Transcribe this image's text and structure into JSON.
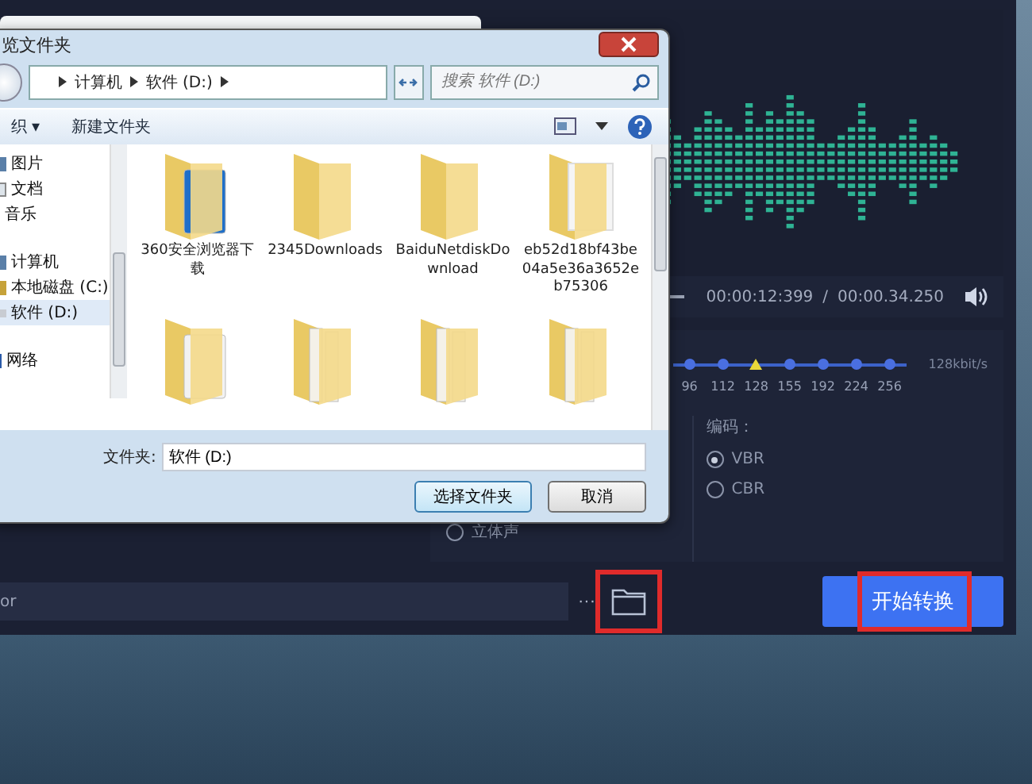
{
  "app": {
    "output_path": "or",
    "browse_button": "···",
    "folder_button": {
      "highlighted": true
    },
    "start_button": {
      "label": "开始转换",
      "highlighted": true
    },
    "player": {
      "current_time": "00:00:12:399",
      "separator": "/",
      "total_time": "00:00.34.250"
    },
    "bitrate": {
      "ticks": [
        {
          "label": "96",
          "selected": false
        },
        {
          "label": "112",
          "selected": false
        },
        {
          "label": "128",
          "selected": true
        },
        {
          "label": "155",
          "selected": false
        },
        {
          "label": "192",
          "selected": false
        },
        {
          "label": "224",
          "selected": false
        },
        {
          "label": "256",
          "selected": false
        }
      ],
      "reading": "128kbit/s"
    },
    "channels": [
      {
        "label": "立体声",
        "selected": false
      }
    ],
    "encoding": {
      "label": "编码：",
      "options": [
        {
          "label": "VBR",
          "selected": true
        },
        {
          "label": "CBR",
          "selected": false
        }
      ]
    }
  },
  "dialog": {
    "title": "览文件夹",
    "breadcrumbs": [
      "计算机",
      "软件 (D:)"
    ],
    "search": {
      "placeholder": "搜索 软件 (D:)"
    },
    "toolbar": {
      "organize": "织 ▾",
      "new_folder": "新建文件夹"
    },
    "nav": [
      {
        "label": "图片",
        "kind": "pictures",
        "selected": false
      },
      {
        "label": "文档",
        "kind": "documents",
        "selected": false
      },
      {
        "label": "音乐",
        "kind": "music",
        "selected": false
      },
      {
        "label": "计算机",
        "kind": "computer",
        "selected": false,
        "children": [
          {
            "label": "本地磁盘 (C:)",
            "kind": "system-drive",
            "selected": false
          },
          {
            "label": "软件 (D:)",
            "kind": "drive",
            "selected": true
          }
        ]
      },
      {
        "label": "网络",
        "kind": "network",
        "selected": false
      }
    ],
    "folders": [
      {
        "name": "360安全浏览器下载",
        "kind": "app"
      },
      {
        "name": "2345Downloads",
        "kind": "plain"
      },
      {
        "name": "BaiduNetdiskDownload",
        "kind": "plain"
      },
      {
        "name": "eb52d18bf43be04a5e36a3652eb75306",
        "kind": "paper"
      },
      {
        "kind": "video"
      },
      {
        "kind": "files"
      },
      {
        "kind": "files"
      },
      {
        "kind": "files"
      }
    ],
    "folder_field": {
      "label": "文件夹:",
      "value": "软件 (D:)"
    },
    "buttons": [
      {
        "label": "选择文件夹",
        "kind": "primary"
      },
      {
        "label": "取消",
        "kind": "normal"
      }
    ]
  }
}
